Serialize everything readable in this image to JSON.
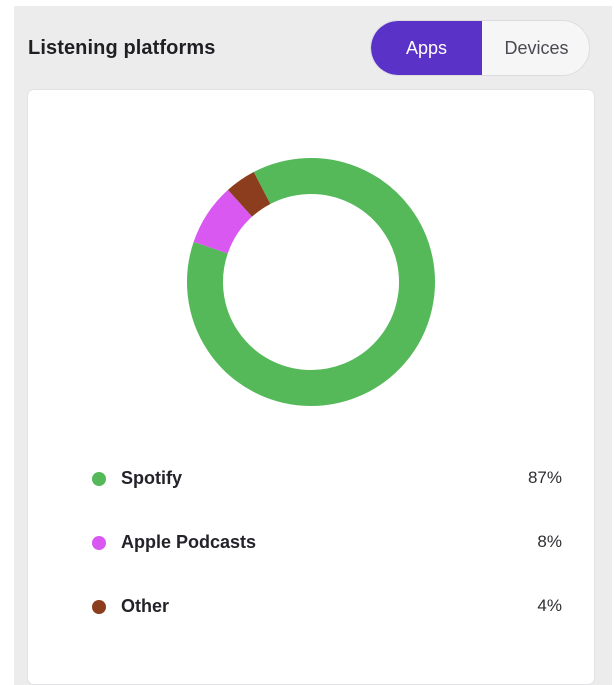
{
  "header": {
    "title": "Listening platforms",
    "toggle": {
      "options": [
        "Apps",
        "Devices"
      ],
      "selected": "Apps"
    }
  },
  "colors": {
    "accent": "#5a32c8",
    "spotify": "#55b95a",
    "apple_podcasts": "#d958f2",
    "other": "#8b3d1d"
  },
  "chart_data": {
    "type": "pie",
    "style": "donut",
    "categories": [
      "Spotify",
      "Apple Podcasts",
      "Other"
    ],
    "values": [
      87,
      8,
      4
    ],
    "value_labels": [
      "87%",
      "8%",
      "4%"
    ],
    "colors": [
      "#55b95a",
      "#d958f2",
      "#8b3d1d"
    ]
  },
  "legend": [
    {
      "label": "Spotify",
      "value": "87%",
      "color": "#55b95a"
    },
    {
      "label": "Apple Podcasts",
      "value": "8%",
      "color": "#d958f2"
    },
    {
      "label": "Other",
      "value": "4%",
      "color": "#8b3d1d"
    }
  ]
}
